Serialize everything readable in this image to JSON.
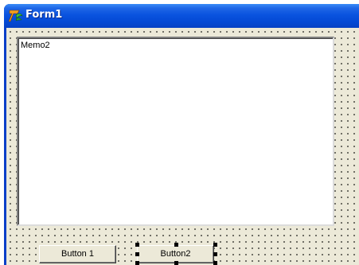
{
  "window": {
    "title": "Form1",
    "icon": "delphi-form-icon"
  },
  "memo": {
    "text": "Memo2"
  },
  "buttons": {
    "button1_label": "Button 1",
    "button2_label": "Button2"
  },
  "colors": {
    "titlebar": "#0a53df",
    "client_background": "#ece9d8",
    "grid_dots": "#000000",
    "memo_background": "#ffffff"
  }
}
